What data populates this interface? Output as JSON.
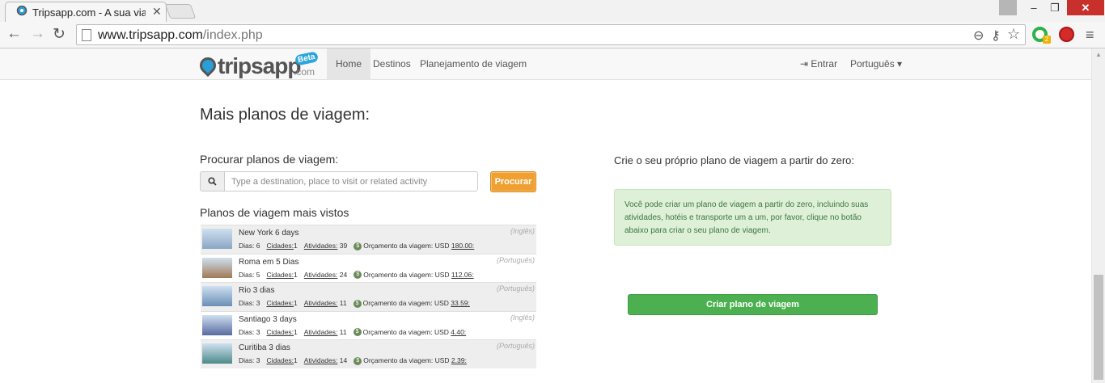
{
  "browser": {
    "tab_title": "Tripsapp.com - A sua viag",
    "url_host": "www.tripsapp.com",
    "url_path": "/index.php",
    "window_controls": {
      "minimize": "–",
      "restore": "❐",
      "close": "✕"
    }
  },
  "navbar": {
    "logo_text": "tripsapp",
    "logo_com": ".com",
    "logo_beta": "Beta",
    "links": {
      "home": "Home",
      "destinos": "Destinos",
      "planejamento": "Planejamento de viagem"
    },
    "login": "Entrar",
    "language": "Português"
  },
  "main": {
    "heading": "Mais planos de viagem:",
    "search_label": "Procurar planos de viagem:",
    "search_placeholder": "Type a destination, place to visit or related activity",
    "search_button": "Procurar",
    "popular_label": "Planos de viagem mais vistos",
    "plans": [
      {
        "title": "New York 6 days",
        "dias": "6",
        "cidades": "1",
        "atividades": "39",
        "orcamento": "180.00:",
        "lang": "(Inglês)",
        "thumb_color": "#8aa6c4"
      },
      {
        "title": "Roma em 5 Dias",
        "dias": "5",
        "cidades": "1",
        "atividades": "24",
        "orcamento": "112.06:",
        "lang": "(Português)",
        "thumb_color": "#a07a56"
      },
      {
        "title": "Rio 3 dias",
        "dias": "3",
        "cidades": "1",
        "atividades": "11",
        "orcamento": "33.59:",
        "lang": "(Português)",
        "thumb_color": "#6a8fb5"
      },
      {
        "title": "Santiago 3 days",
        "dias": "3",
        "cidades": "1",
        "atividades": "11",
        "orcamento": "4.40:",
        "lang": "(Inglês)",
        "thumb_color": "#5a6aa0"
      },
      {
        "title": "Curitiba 3 dias",
        "dias": "3",
        "cidades": "1",
        "atividades": "14",
        "orcamento": "2.39:",
        "lang": "(Português)",
        "thumb_color": "#4d8a8a"
      }
    ],
    "meta_labels": {
      "dias": "Dias:",
      "cidades": "Cidades:",
      "atividades": "Atividades:",
      "orcamento": "Orçamento da viagem:",
      "currency": "USD"
    }
  },
  "create": {
    "label": "Crie o seu próprio plano de viagem a partir do zero:",
    "info": "Você pode criar um plano de viagem a partir do zero, incluindo suas atividades, hotéis e transporte um a um, por favor, clique no botão abaixo para criar o seu plano de viagem.",
    "button": "Criar plano de viagem"
  },
  "colors": {
    "accent_orange": "#f0a030",
    "accent_green": "#4cb050",
    "info_bg": "#dff0d8"
  }
}
